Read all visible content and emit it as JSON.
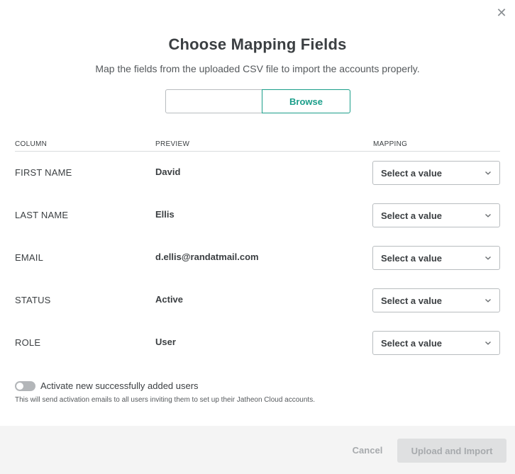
{
  "dialog": {
    "close_icon": "close-icon",
    "title": "Choose Mapping Fields",
    "subtitle": "Map the fields from the uploaded CSV file to import the accounts properly."
  },
  "file_picker": {
    "value": "",
    "browse_label": "Browse"
  },
  "table": {
    "headers": {
      "column": "COLUMN",
      "preview": "PREVIEW",
      "mapping": "MAPPING"
    },
    "rows": [
      {
        "column": "FIRST NAME",
        "preview": "David",
        "mapping": "Select a value"
      },
      {
        "column": "LAST NAME",
        "preview": "Ellis",
        "mapping": "Select a value"
      },
      {
        "column": "EMAIL",
        "preview": "d.ellis@randatmail.com",
        "mapping": "Select a value"
      },
      {
        "column": "STATUS",
        "preview": "Active",
        "mapping": "Select a value"
      },
      {
        "column": "ROLE",
        "preview": "User",
        "mapping": "Select a value"
      }
    ]
  },
  "activation": {
    "toggle_on": false,
    "label": "Activate new successfully added users",
    "hint": "This will send activation emails to all users inviting them to set up their Jatheon Cloud accounts."
  },
  "footer": {
    "cancel_label": "Cancel",
    "upload_label": "Upload and Import",
    "upload_disabled": true
  },
  "colors": {
    "accent": "#1a9e8a",
    "text": "#3b3f42",
    "disabled_text": "#a7aaad",
    "footer_bg": "#f4f4f4",
    "toggle_off": "#b3b6b9"
  }
}
